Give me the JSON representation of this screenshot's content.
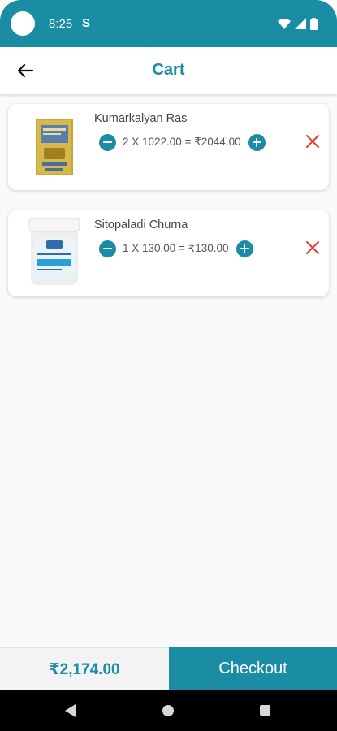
{
  "status_bar": {
    "time": "8:25",
    "app_indicator": "S",
    "icons": [
      "wifi-icon",
      "signal-icon",
      "battery-icon"
    ]
  },
  "app_bar": {
    "title": "Cart",
    "back_icon": "arrow-back-icon"
  },
  "cart": {
    "items": [
      {
        "name": "Kumarkalyan Ras",
        "quantity_line": "2 X 1022.00 = ₹2044.00",
        "image_icon": "product-box-icon"
      },
      {
        "name": "Sitopaladi Churna",
        "quantity_line": "1 X 130.00 = ₹130.00",
        "image_icon": "product-jar-icon"
      }
    ]
  },
  "footer": {
    "total": "₹2,174.00",
    "checkout_label": "Checkout"
  },
  "colors": {
    "accent": "#1a8ca3",
    "remove": "#e53935",
    "background": "#fafafa"
  }
}
